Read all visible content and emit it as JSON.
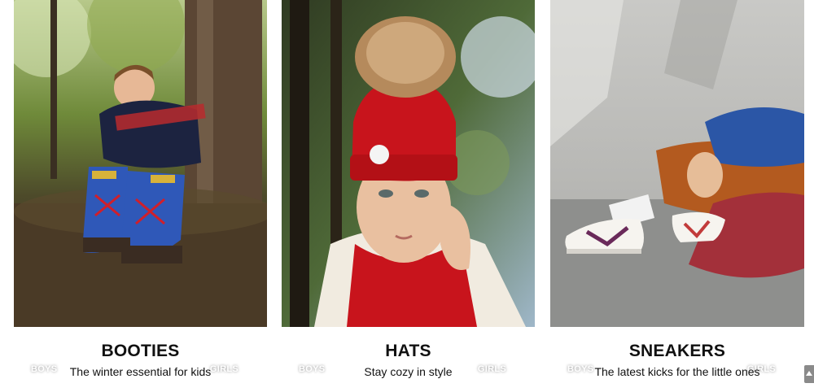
{
  "categories": [
    {
      "title": "BOOTIES",
      "subtitle": "The winter essential for kids",
      "boys_label": "BOYS",
      "girls_label": "GIRLS",
      "image": "child-in-blue-booties-by-tree"
    },
    {
      "title": "HATS",
      "subtitle": "Stay cozy in style",
      "boys_label": "BOYS",
      "girls_label": "GIRLS",
      "image": "child-in-red-pom-pom-beanie"
    },
    {
      "title": "SNEAKERS",
      "subtitle": "The latest kicks for the little ones",
      "boys_label": "BOYS",
      "girls_label": "GIRLS",
      "image": "child-in-white-sneakers-by-wall"
    }
  ],
  "icons": {
    "link_arrow": "play-triangle-icon",
    "scroll_to_top": "caret-up-icon"
  },
  "colors": {
    "text": "#111111",
    "overlay_text": "#ffffff",
    "hat_red": "#c8141c",
    "boot_blue": "#2f58b8"
  }
}
